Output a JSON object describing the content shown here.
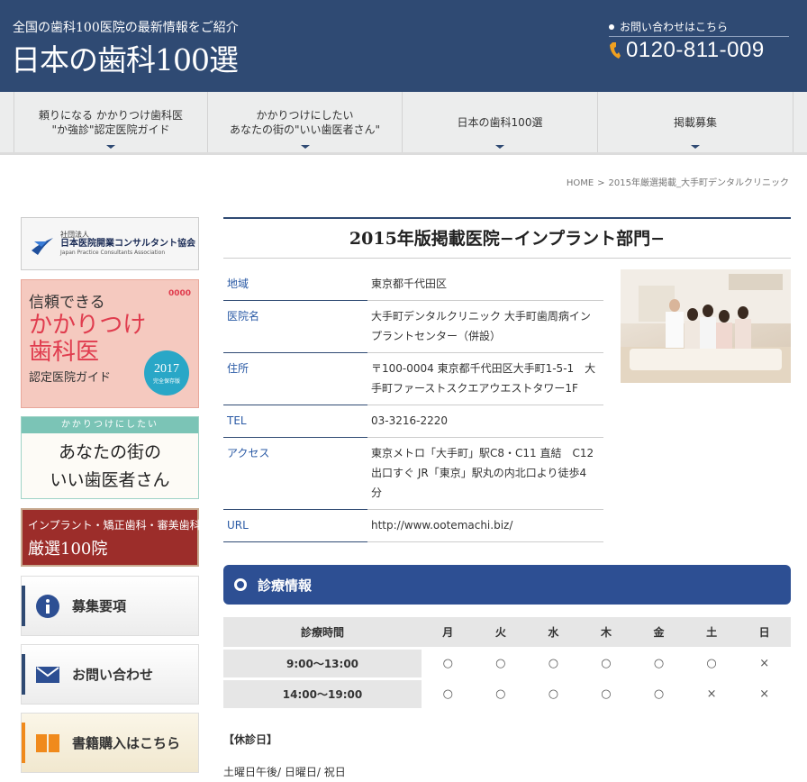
{
  "header": {
    "tagline": "全国の歯科100医院の最新情報をご紹介",
    "site_title": "日本の歯科100選",
    "contact_label": "お問い合わせはこちら",
    "phone": "0120-811-009"
  },
  "nav": {
    "items": [
      {
        "line1": "頼りになる かかりつけ歯科医",
        "line2": "\"か強診\"認定医院ガイド"
      },
      {
        "line1": "かかりつけにしたい",
        "line2": "あなたの街の\"いい歯医者さん\""
      },
      {
        "line1": "日本の歯科100選",
        "line2": ""
      },
      {
        "line1": "掲載募集",
        "line2": ""
      }
    ]
  },
  "breadcrumb": {
    "home": "HOME",
    "sep": ">",
    "current": "2015年厳選掲載_大手町デンタルクリニック"
  },
  "sidebar": {
    "assoc": {
      "small": "社団法人",
      "name": "日本医院開業コンサルタント協会",
      "en": "Japan Practice Consultants Association"
    },
    "guide": {
      "l1": "信頼できる",
      "l2": "かかりつけ",
      "l3": "歯科医",
      "l4": "認定医院ガイド",
      "year": "2017",
      "year_sub": "完全保存版",
      "counter": "0000"
    },
    "town": {
      "band": "かかりつけにしたい",
      "l1": "あなたの街の",
      "l2": "いい歯医者さん"
    },
    "implant": {
      "l1": "インプラント・矯正歯科・審美歯科",
      "l2": "厳選100院"
    },
    "recruit": "募集要項",
    "contact": "お問い合わせ",
    "books": "書籍購入はこちら"
  },
  "main": {
    "title": "2015年版掲載医院−インプラント部門−",
    "info": [
      {
        "key": "地域",
        "value": "東京都千代田区"
      },
      {
        "key": "医院名",
        "value": "大手町デンタルクリニック 大手町歯周病インプラントセンター（併設）"
      },
      {
        "key": "住所",
        "value": "〒100-0004 東京都千代田区大手町1-5-1　大手町ファーストスクエアウエストタワー1F"
      },
      {
        "key": "TEL",
        "value": "03-3216-2220"
      },
      {
        "key": "アクセス",
        "value": "東京メトロ「大手町」駅C8・C11 直結　C12出口すぐ JR「東京」駅丸の内北口より徒歩4 分"
      },
      {
        "key": "URL",
        "value": "http://www.ootemachi.biz/"
      }
    ],
    "section_title": "診療情報",
    "hours": {
      "header": [
        "診療時間",
        "月",
        "火",
        "水",
        "木",
        "金",
        "土",
        "日"
      ],
      "rows": [
        {
          "slot": "9:00～13:00",
          "marks": [
            "○",
            "○",
            "○",
            "○",
            "○",
            "○",
            "×"
          ]
        },
        {
          "slot": "14:00～19:00",
          "marks": [
            "○",
            "○",
            "○",
            "○",
            "○",
            "×",
            "×"
          ]
        }
      ]
    },
    "holiday_label": "【休診日】",
    "holiday_text": "土曜日午後/ 日曜日/ 祝日"
  },
  "colors": {
    "header_bg": "#2f4a73",
    "section_bg": "#2d4f93",
    "link": "#2a5aa5"
  }
}
